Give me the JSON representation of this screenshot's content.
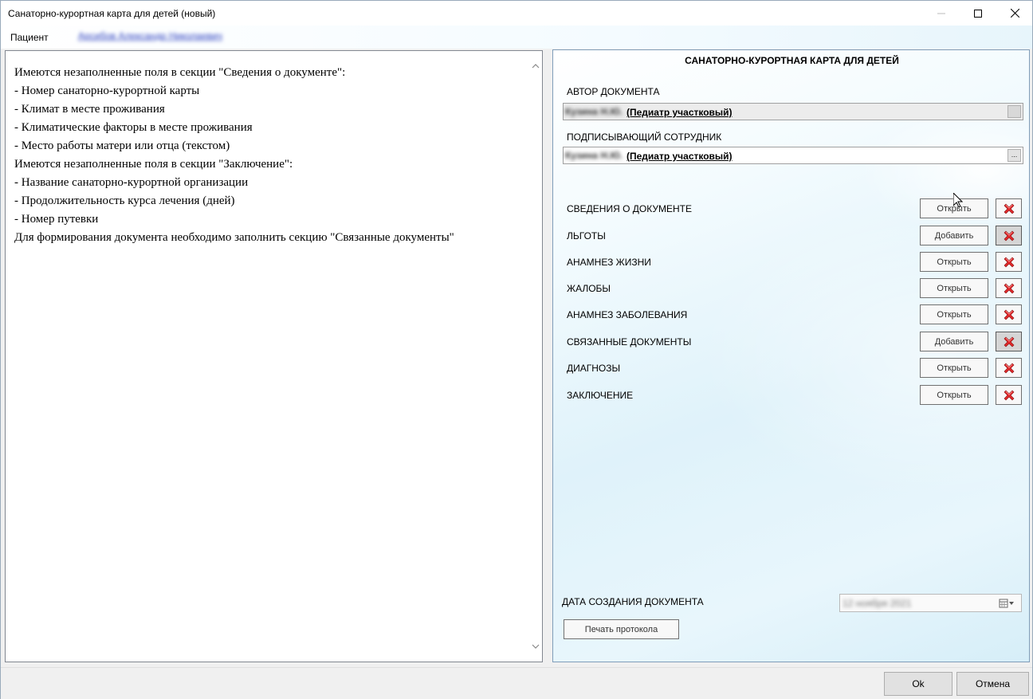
{
  "window": {
    "title": "Санаторно-курортная карта для детей (новый)",
    "min_icon": "minimize-icon",
    "max_icon": "maximize-icon",
    "close_icon": "close-icon"
  },
  "patient": {
    "label": "Пациент",
    "name": "Арсибов Александр Николаевич"
  },
  "messages": [
    "Имеются незаполненные поля в секции \"Сведения о документе\":",
    "- Номер санаторно-курортной карты",
    "- Климат в месте проживания",
    "- Климатические факторы в месте проживания",
    "- Место работы матери или отца (текстом)",
    "Имеются незаполненные поля в секции \"Заключение\":",
    "- Название санаторно-курортной организации",
    "- Продолжительность курса лечения (дней)",
    "- Номер путевки",
    "Для формирования документа необходимо заполнить секцию \"Связанные документы\""
  ],
  "document": {
    "title": "САНАТОРНО-КУРОРТНАЯ КАРТА ДЛЯ ДЕТЕЙ",
    "author_label": "АВТОР ДОКУМЕНТА",
    "author_name": "Кузина Н.Ю.",
    "author_role": "(Педиатр участковый)",
    "signer_label": "ПОДПИСЫВАЮЩИЙ СОТРУДНИК",
    "signer_name": "Кузина Н.Ю.",
    "signer_role": "(Педиатр участковый)",
    "signer_button": "..."
  },
  "sections": [
    {
      "label": "СВЕДЕНИЯ О ДОКУМЕНТЕ",
      "action": "Открыть",
      "delete_pressed": false
    },
    {
      "label": "ЛЬГОТЫ",
      "action": "Добавить",
      "delete_pressed": true
    },
    {
      "label": "АНАМНЕЗ ЖИЗНИ",
      "action": "Открыть",
      "delete_pressed": false
    },
    {
      "label": "ЖАЛОБЫ",
      "action": "Открыть",
      "delete_pressed": false
    },
    {
      "label": "АНАМНЕЗ ЗАБОЛЕВАНИЯ",
      "action": "Открыть",
      "delete_pressed": false
    },
    {
      "label": "СВЯЗАННЫЕ ДОКУМЕНТЫ",
      "action": "Добавить",
      "delete_pressed": true
    },
    {
      "label": "ДИАГНОЗЫ",
      "action": "Открыть",
      "delete_pressed": false
    },
    {
      "label": "ЗАКЛЮЧЕНИЕ",
      "action": "Открыть",
      "delete_pressed": false
    }
  ],
  "date": {
    "label": "ДАТА СОЗДАНИЯ ДОКУМЕНТА",
    "value": "12 ноября 2021",
    "icon": "calendar-dropdown-icon"
  },
  "print_button": "Печать протокола",
  "footer": {
    "ok": "Ok",
    "cancel": "Отмена"
  },
  "colors": {
    "delete_icon": "#e0282a",
    "panel_accent": "#dff2fa"
  }
}
